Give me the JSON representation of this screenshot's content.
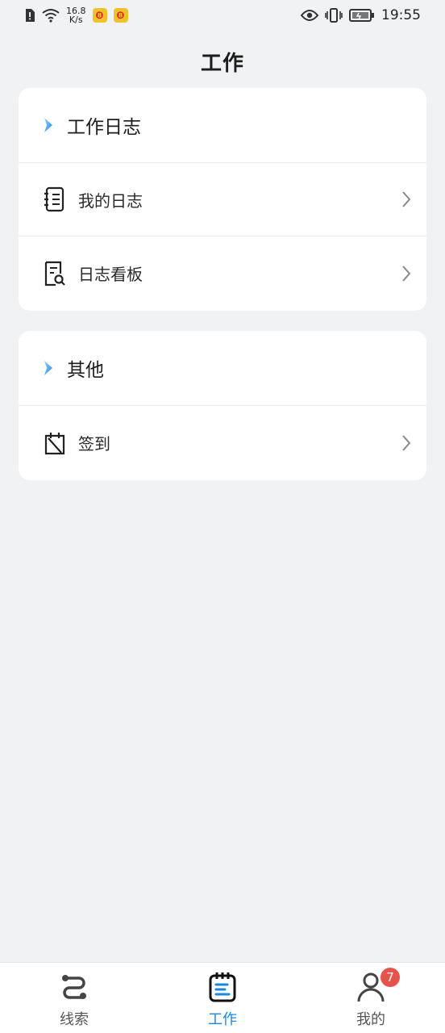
{
  "status_bar": {
    "net_speed_value": "16.8",
    "net_speed_unit": "K/s",
    "time": "19:55",
    "app_badge_glyph": "❽"
  },
  "header": {
    "title": "工作"
  },
  "sections": [
    {
      "title": "工作日志",
      "items": [
        {
          "label": "我的日志",
          "icon": "journal-icon"
        },
        {
          "label": "日志看板",
          "icon": "document-search-icon"
        }
      ]
    },
    {
      "title": "其他",
      "items": [
        {
          "label": "签到",
          "icon": "calendar-checkin-icon"
        }
      ]
    }
  ],
  "tab_bar": {
    "tabs": [
      {
        "label": "线索",
        "icon": "route-icon",
        "active": false
      },
      {
        "label": "工作",
        "icon": "work-notebook-icon",
        "active": true
      },
      {
        "label": "我的",
        "icon": "person-icon",
        "active": false,
        "badge": "7"
      }
    ]
  },
  "colors": {
    "accent": "#1d87d9",
    "background": "#f1f2f4",
    "card": "#ffffff",
    "badge": "#e5534b"
  }
}
